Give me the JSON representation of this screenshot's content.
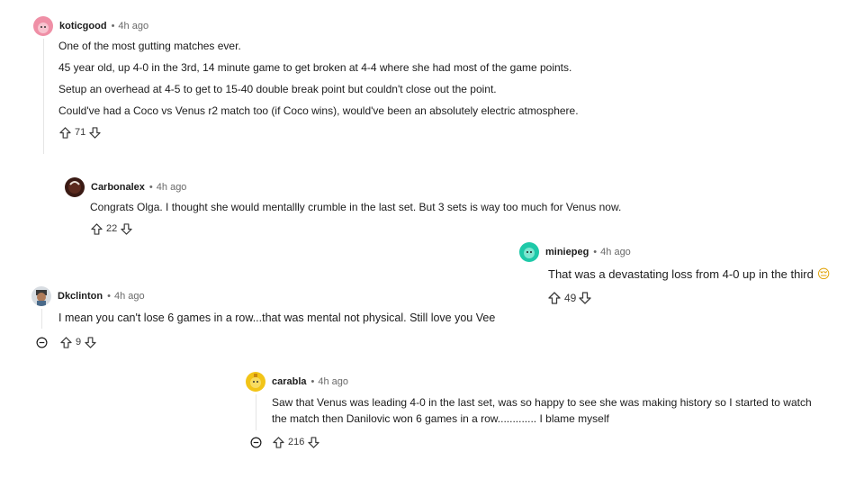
{
  "comments": [
    {
      "username": "koticgood",
      "time": "4h ago",
      "paragraphs": [
        "One of the most gutting matches ever.",
        "45 year old, up 4-0 in the 3rd, 14 minute game to get broken at 4-4 where she had most of the game points.",
        "Setup an overhead at 4-5 to get to 15-40 double break point but couldn't close out the point.",
        "Could've had a Coco vs Venus r2 match too (if Coco wins), would've been an absolutely electric atmosphere."
      ],
      "votes": "71",
      "avatar_color": "#ef8fa6"
    },
    {
      "username": "Carbonalex",
      "time": "4h ago",
      "paragraphs": [
        "Congrats Olga. I thought she would mentallly crumble in the last set. But 3 sets is way too much for Venus now."
      ],
      "votes": "22",
      "avatar_color": "#3a1a14"
    },
    {
      "username": "miniepeg",
      "time": "4h ago",
      "paragraphs": [
        "That was a devastating loss from 4-0 up in the third"
      ],
      "votes": "49",
      "avatar_color": "#1ec9a8",
      "emoji": "😔"
    },
    {
      "username": "Dkclinton",
      "time": "4h ago",
      "paragraphs": [
        "I mean you can't lose 6 games in a row...that was mental not physical. Still love you Vee"
      ],
      "votes": "9",
      "avatar_color": "#7a8a9a"
    },
    {
      "username": "carabla",
      "time": "4h ago",
      "paragraphs": [
        "Saw that Venus was leading 4-0 in the last set, was so happy to see she was making history so I started to watch",
        "the match then Danilovic won 6 games in a row............. I blame myself"
      ],
      "votes": "216",
      "avatar_color": "#f2c417"
    }
  ],
  "separator": "•"
}
